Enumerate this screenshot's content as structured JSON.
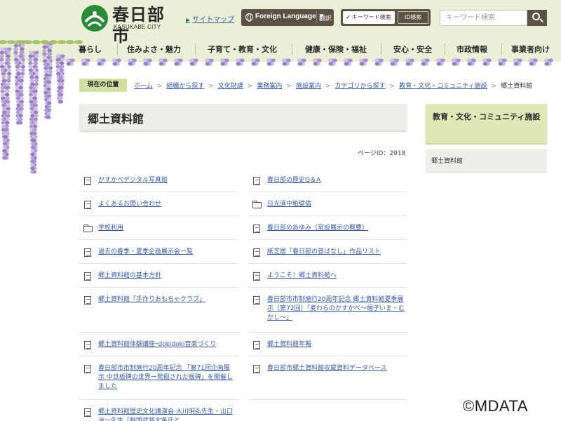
{
  "header": {
    "logo_name": "春日部市",
    "logo_sub": "KASUKABE CITY",
    "sitemap": "サイトマップ",
    "foreign_language": "Foreign Language ▼",
    "translate": "翻訳",
    "search_mode_keyword": "キーワード検索",
    "search_mode_id": "ID検索",
    "search_placeholder": "キーワード検索",
    "brand_color": "#2a8a3a"
  },
  "global_nav": [
    "暮らし",
    "住みよさ・魅力",
    "子育て・教育・文化",
    "健康・保険・福祉",
    "安心・安全",
    "市政情報",
    "事業者向け"
  ],
  "breadcrumb": {
    "label": "現在の位置",
    "items": [
      "ホーム",
      "組織から探す",
      "文化財課",
      "業務案内",
      "施設案内",
      "カテゴリから探す",
      "教育・文化・コミュニティ施設"
    ],
    "current": "郷土資料館"
  },
  "page": {
    "title": "郷土資料館",
    "page_id": "ページID：2918"
  },
  "links": [
    {
      "text": "かすかべデジタル写真館",
      "icon": "document-icon"
    },
    {
      "text": "春日部の歴史Q＆A",
      "icon": "document-icon"
    },
    {
      "text": "よくあるお問い合わせ",
      "icon": "document-icon"
    },
    {
      "text": "日光道中粕壁宿",
      "icon": "folder-icon"
    },
    {
      "text": "学校利用",
      "icon": "folder-icon"
    },
    {
      "text": "春日部のあゆみ（常設展示の概要）",
      "icon": "document-icon"
    },
    {
      "text": "過去の春季・夏季企画展示会一覧",
      "icon": "document-icon"
    },
    {
      "text": "紙芝居「春日部の昔ばなし」作品リスト",
      "icon": "document-icon"
    },
    {
      "text": "郷土資料館の基本方針",
      "icon": "document-icon"
    },
    {
      "text": "ようこそ！郷土資料館へ",
      "icon": "document-icon"
    },
    {
      "text": "郷土資料館「手作りおもちゃクラブ」",
      "icon": "document-icon"
    },
    {
      "text": "春日部市市制施行20周年記念 郷土資料館夏季展示（第72回）「麦わらのかすかべ～帽子いま・むかし～」",
      "icon": "document-icon"
    },
    {
      "text": "郷土資料館体験講座ｰdokidoki音楽づくり",
      "icon": "document-icon"
    },
    {
      "text": "郷土資料館年報",
      "icon": "document-icon"
    },
    {
      "text": "春日部市市制施行20周年記念 「第71回企画展示 中世板碑の世界ー発掘された板碑」を開催しました",
      "icon": "document-icon"
    },
    {
      "text": "春日部市郷土資料館収蔵資料データベース",
      "icon": "document-icon"
    },
    {
      "text": "郷土資料館歴史文化講演会 大川明弘先生・山口治一先生「戦国武将北条氏と",
      "icon": "document-icon"
    }
  ],
  "sidebar": {
    "heading": "教育・文化・コミュニティ施設",
    "items": [
      "郷土資料館"
    ]
  },
  "watermark": "©MDATA"
}
